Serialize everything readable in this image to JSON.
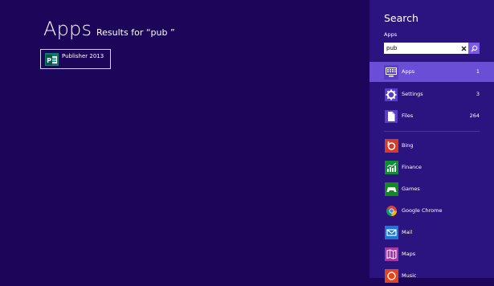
{
  "results": {
    "title": "Apps",
    "query_text": "Results for “pub ”",
    "items": [
      {
        "label": "Publisher 2013",
        "icon": "publisher-icon",
        "icon_color": "#0a7d6f"
      }
    ]
  },
  "search": {
    "title": "Search",
    "scope": "Apps",
    "query": "pub",
    "clear_icon": "close-icon",
    "search_icon": "search-icon",
    "categories": [
      {
        "label": "Apps",
        "count": "1",
        "icon": "keyboard-icon",
        "selected": true
      },
      {
        "label": "Settings",
        "count": "3",
        "icon": "gear-icon",
        "selected": false
      },
      {
        "label": "Files",
        "count": "264",
        "icon": "document-icon",
        "selected": false
      }
    ],
    "apps": [
      {
        "label": "Bing",
        "icon": "bing-icon",
        "color": "#d63b26"
      },
      {
        "label": "Finance",
        "icon": "finance-icon",
        "color": "#0f8f33"
      },
      {
        "label": "Games",
        "icon": "gamepad-icon",
        "color": "#138a1f"
      },
      {
        "label": "Google Chrome",
        "icon": "chrome-icon",
        "color": "#2c1480"
      },
      {
        "label": "Mail",
        "icon": "mail-icon",
        "color": "#1c78d6"
      },
      {
        "label": "Maps",
        "icon": "maps-icon",
        "color": "#a33aa3"
      },
      {
        "label": "Music",
        "icon": "music-icon",
        "color": "#e0451f"
      }
    ]
  },
  "colors": {
    "background": "#1b065a",
    "pane": "#2c1480",
    "selected_row": "#6a4fd6",
    "search_button": "#7b5ae8"
  }
}
